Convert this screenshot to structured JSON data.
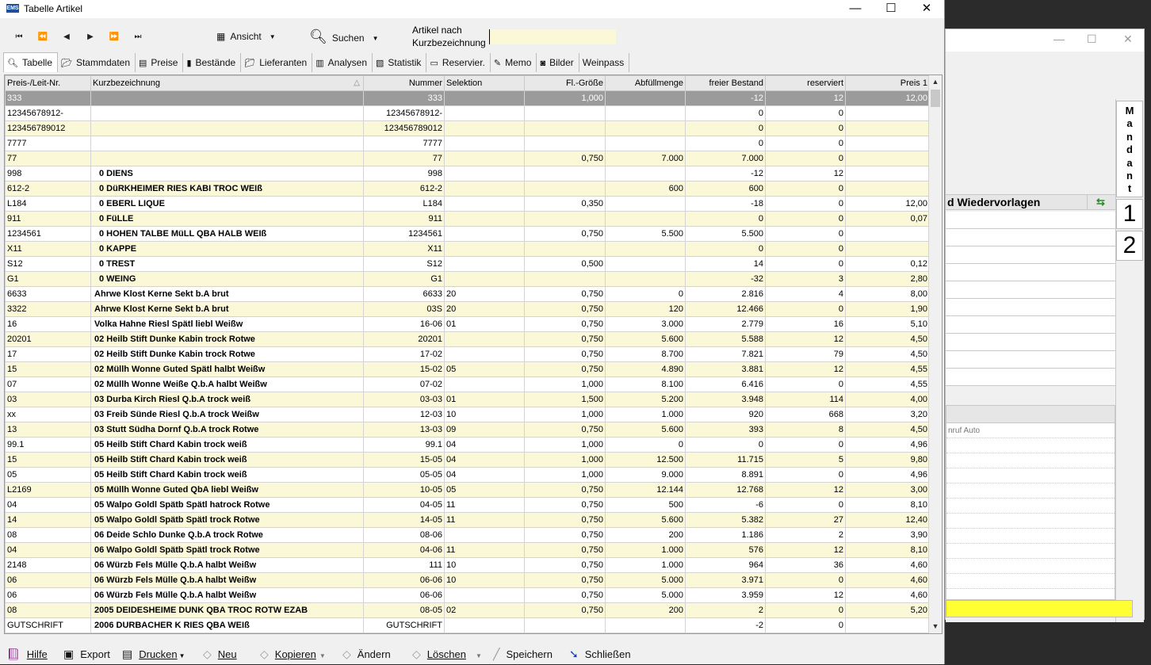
{
  "window": {
    "title": "Tabelle Artikel",
    "app_icon": "EMS",
    "minimize": "—",
    "maximize": "☐",
    "close": "✕"
  },
  "toolbar": {
    "nav": [
      "⏮",
      "⏪",
      "◀",
      "▶",
      "⏩",
      "⏭"
    ],
    "view_label": "Ansicht",
    "search_label": "Suchen",
    "field_label_line1": "Artikel nach",
    "field_label_line2": "Kurzbezeichnung",
    "field_value": ""
  },
  "tabs": [
    {
      "label": "Tabelle",
      "active": true,
      "icon": "table-view-icon"
    },
    {
      "label": "Stammdaten",
      "icon": "folder-icon"
    },
    {
      "label": "Preise",
      "icon": "price-icon"
    },
    {
      "label": "Bestände",
      "icon": "stock-icon"
    },
    {
      "label": "Lieferanten",
      "icon": "supplier-icon"
    },
    {
      "label": "Analysen",
      "icon": "analysis-icon"
    },
    {
      "label": "Statistik",
      "icon": "statistics-icon"
    },
    {
      "label": "Reservier.",
      "icon": "reservation-icon"
    },
    {
      "label": "Memo",
      "icon": "memo-icon"
    },
    {
      "label": "Bilder",
      "icon": "camera-icon"
    },
    {
      "label": "Weinpass",
      "icon": ""
    }
  ],
  "grid": {
    "columns": [
      "Preis-/Leit-Nr.",
      "Kurzbezeichnung",
      "Nummer",
      "Selektion",
      "Fl.-Größe",
      "Abfüllmenge",
      "freier Bestand",
      "reserviert",
      "Preis 1"
    ],
    "sort_indicator": "△",
    "rows": [
      [
        "333",
        "",
        "333",
        "",
        "1,000",
        "",
        "-12",
        "12",
        "12,00"
      ],
      [
        "12345678912-",
        "",
        "12345678912-",
        "",
        "",
        "",
        "0",
        "0",
        ""
      ],
      [
        "123456789012",
        "",
        "123456789012",
        "",
        "",
        "",
        "0",
        "0",
        ""
      ],
      [
        "7777",
        "",
        "7777",
        "",
        "",
        "",
        "0",
        "0",
        ""
      ],
      [
        "77",
        "",
        "77",
        "",
        "0,750",
        "7.000",
        "7.000",
        "0",
        ""
      ],
      [
        "998",
        "0 DIENS",
        "998",
        "",
        "",
        "",
        "-12",
        "12",
        ""
      ],
      [
        "612-2",
        "0 DüRKHEIMER  RIES KABI TROC WEIß",
        "612-2",
        "",
        "",
        "600",
        "600",
        "0",
        ""
      ],
      [
        "L184",
        "0 EBERL LIQUE",
        "L184",
        "",
        "0,350",
        "",
        "-18",
        "0",
        "12,00"
      ],
      [
        "911",
        "0 FüLLE",
        "911",
        "",
        "",
        "",
        "0",
        "0",
        "0,07"
      ],
      [
        "1234561",
        "0 HOHEN TALBE MüLL QBA HALB WEIß",
        "1234561",
        "",
        "0,750",
        "5.500",
        "5.500",
        "0",
        ""
      ],
      [
        "X11",
        "0 KAPPE",
        "X11",
        "",
        "",
        "",
        "0",
        "0",
        ""
      ],
      [
        "S12",
        "0 TREST",
        "S12",
        "",
        "0,500",
        "",
        "14",
        "0",
        "0,12"
      ],
      [
        "G1",
        "0 WEING",
        "G1",
        "",
        "",
        "",
        "-32",
        "3",
        "2,80"
      ],
      [
        "6633",
        "Ahrwe Klost Kerne Sekt b.A brut",
        "6633",
        "20",
        "0,750",
        "0",
        "2.816",
        "4",
        "8,00"
      ],
      [
        "3322",
        "Ahrwe Klost Kerne Sekt b.A brut",
        "03S",
        "20",
        "0,750",
        "120",
        "12.466",
        "0",
        "1,90"
      ],
      [
        "16",
        "Volka Hahne Riesl Spätl liebl Weißw",
        "16-06",
        "01",
        "0,750",
        "3.000",
        "2.779",
        "16",
        "5,10"
      ],
      [
        "20201",
        "02 Heilb Stift Dunke Kabin trock Rotwe",
        "20201",
        "",
        "0,750",
        "5.600",
        "5.588",
        "12",
        "4,50"
      ],
      [
        "17",
        "02 Heilb Stift Dunke Kabin trock Rotwe",
        "17-02",
        "",
        "0,750",
        "8.700",
        "7.821",
        "79",
        "4,50"
      ],
      [
        "15",
        "02 Müllh Wonne Guted Spätl halbt Weißw",
        "15-02",
        "05",
        "0,750",
        "4.890",
        "3.881",
        "12",
        "4,55"
      ],
      [
        "07",
        "02 Müllh Wonne Weiße Q.b.A halbt Weißw",
        "07-02",
        "",
        "1,000",
        "8.100",
        "6.416",
        "0",
        "4,55"
      ],
      [
        "03",
        "03 Durba Kirch Riesl Q.b.A trock weiß",
        "03-03",
        "01",
        "1,500",
        "5.200",
        "3.948",
        "114",
        "4,00"
      ],
      [
        "xx",
        "03 Freib Sünde Riesl Q.b.A trock Weißw",
        "12-03",
        "10",
        "1,000",
        "1.000",
        "920",
        "668",
        "3,20"
      ],
      [
        "13",
        "03 Stutt Südha Dornf Q.b.A trock Rotwe",
        "13-03",
        "09",
        "0,750",
        "5.600",
        "393",
        "8",
        "4,50"
      ],
      [
        "99.1",
        "05 Heilb Stift Chard Kabin trock weiß",
        "99.1",
        "04",
        "1,000",
        "0",
        "0",
        "0",
        "4,96"
      ],
      [
        "15",
        "05 Heilb Stift Chard Kabin trock weiß",
        "15-05",
        "04",
        "1,000",
        "12.500",
        "11.715",
        "5",
        "9,80"
      ],
      [
        "05",
        "05 Heilb Stift Chard Kabin trock weiß",
        "05-05",
        "04",
        "1,000",
        "9.000",
        "8.891",
        "0",
        "4,96"
      ],
      [
        "L2169",
        "05 Müllh Wonne Guted QbA liebl Weißw",
        "10-05",
        "05",
        "0,750",
        "12.144",
        "12.768",
        "12",
        "3,00"
      ],
      [
        "04",
        "05 Walpo Goldl Spätb Spätl hatrock Rotwe",
        "04-05",
        "11",
        "0,750",
        "500",
        "-6",
        "0",
        "8,10"
      ],
      [
        "14",
        "05 Walpo Goldl Spätb Spätl trock Rotwe",
        "14-05",
        "11",
        "0,750",
        "5.600",
        "5.382",
        "27",
        "12,40"
      ],
      [
        "08",
        "06 Deide Schlo Dunke Q.b.A trock Rotwe",
        "08-06",
        "",
        "0,750",
        "200",
        "1.186",
        "2",
        "3,90"
      ],
      [
        "04",
        "06 Walpo Goldl Spätb Spätl trock Rotwe",
        "04-06",
        "11",
        "0,750",
        "1.000",
        "576",
        "12",
        "8,10"
      ],
      [
        "2148",
        "06 Würzb Fels Mülle Q.b.A halbt Weißw",
        "111",
        "10",
        "0,750",
        "1.000",
        "964",
        "36",
        "4,60"
      ],
      [
        "06",
        "06 Würzb Fels Mülle Q.b.A halbt Weißw",
        "06-06",
        "10",
        "0,750",
        "5.000",
        "3.971",
        "0",
        "4,60"
      ],
      [
        "06",
        "06 Würzb Fels Mülle Q.b.A halbt Weißw",
        "06-06",
        "",
        "0,750",
        "5.000",
        "3.959",
        "12",
        "4,60"
      ],
      [
        "08",
        "2005 DEIDESHEIME DUNK QBA TROC ROTW EZAB",
        "08-05",
        "02",
        "0,750",
        "200",
        "2",
        "0",
        "5,20"
      ],
      [
        "GUTSCHRIFT",
        "2006 DURBACHER K RIES QBA WEIß",
        "GUTSCHRIFT",
        "",
        "",
        "",
        "-2",
        "0",
        ""
      ]
    ]
  },
  "statusbar": {
    "help": "Hilfe",
    "export": "Export",
    "print": "Drucken",
    "new": "Neu",
    "copy": "Kopieren",
    "edit": "Ändern",
    "delete": "Löschen",
    "save": "Speichern",
    "close": "Schließen"
  },
  "background_window": {
    "minimize": "—",
    "maximize": "☐",
    "close": "✕",
    "mandant_label": "Mandant",
    "header": "d Wiedervorlagen",
    "client_1": "1",
    "client_2": "2",
    "list_item": "nruf Auto"
  },
  "colors": {
    "alt_row": "#fbf8d8",
    "selected_row": "#9b9b9b",
    "highlight": "#ffff33"
  }
}
